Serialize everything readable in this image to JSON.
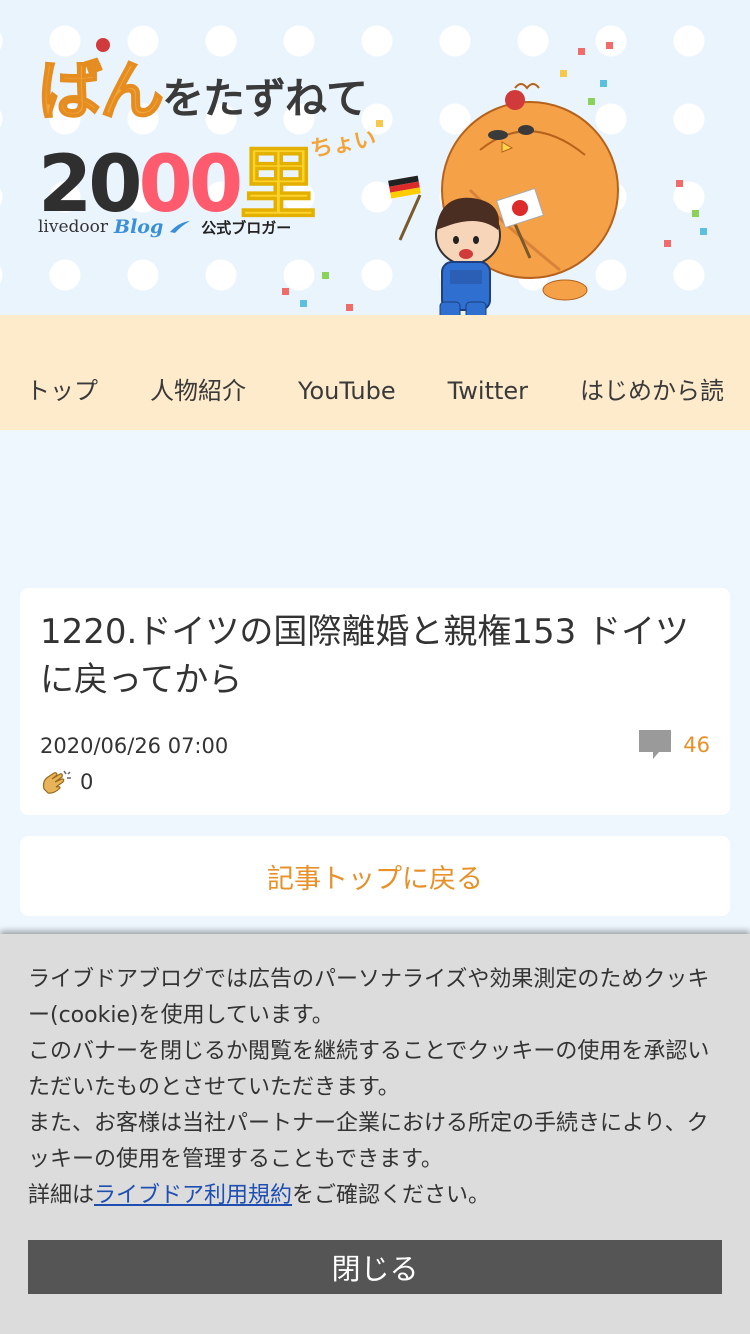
{
  "header": {
    "logo": {
      "line1_ban": "ばん",
      "line1_rest": "をたずねて",
      "line2_d1": "20",
      "line2_d2": "00",
      "line2_sato": "里",
      "chotto": "ちょい",
      "livedoor": "livedoor",
      "blog": "Blog",
      "official": "公式ブロガー"
    }
  },
  "nav": {
    "items": [
      {
        "label": "トップ"
      },
      {
        "label": "人物紹介"
      },
      {
        "label": "YouTube"
      },
      {
        "label": "Twitter"
      },
      {
        "label": "はじめから読"
      }
    ]
  },
  "article": {
    "title": "1220.ドイツの国際離婚と親権153 ドイツに戻ってから",
    "date": "2020/06/26 07:00",
    "comment_count": "46",
    "clap_count": "0"
  },
  "back_button": {
    "label": "記事トップに戻る"
  },
  "cookie_banner": {
    "line1": "ライブドアブログでは広告のパーソナライズや効果測定のためクッキー(cookie)を使用しています。",
    "line2": "このバナーを閉じるか閲覧を継続することでクッキーの使用を承認いただいたものとさせていただきます。",
    "line3": "また、お客様は当社パートナー企業における所定の手続きにより、クッキーの使用を管理することもできます。",
    "line4_prefix": "詳細は",
    "line4_link": "ライブドア利用規約",
    "line4_suffix": "をご確認ください。",
    "close_label": "閉じる"
  },
  "colors": {
    "accent_orange": "#e8902a",
    "nav_bg": "#fdebcc",
    "page_bg": "#eef6fe",
    "link_blue": "#1f4fb0",
    "close_button_bg": "#555555"
  },
  "icons": {
    "comment": "comment-bubble-icon",
    "clap": "clap-icon"
  }
}
